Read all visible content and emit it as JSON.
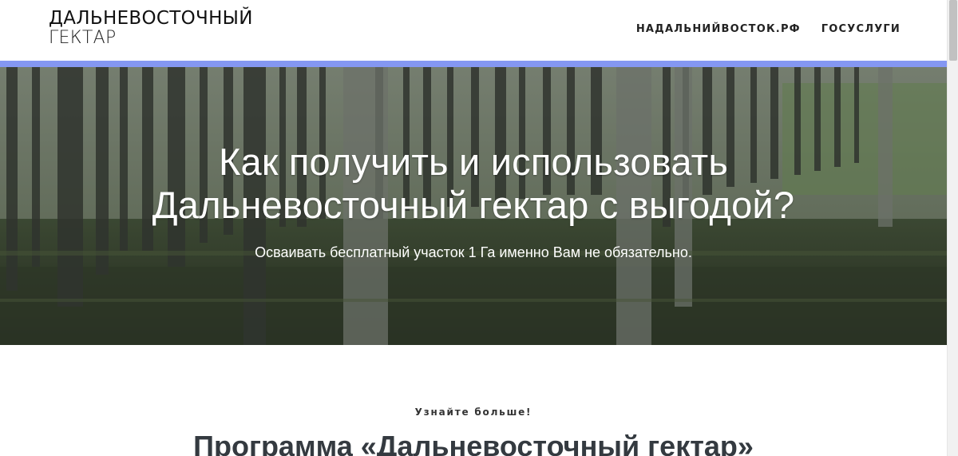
{
  "header": {
    "logo_line1": "ДАЛЬНЕВОСТОЧНЫЙ",
    "logo_line2": "ГЕКТАР",
    "nav": [
      {
        "label": "НАДАЛЬНИЙВОСТОК.РФ"
      },
      {
        "label": "ГОСУСЛУГИ"
      }
    ]
  },
  "colors": {
    "accent_bar": "#8497f2",
    "hero_text": "#ffffff",
    "section_title": "#343a40"
  },
  "hero": {
    "title_line1": "Как получить и использовать",
    "title_line2": "Дальневосточный гектар с выгодой?",
    "subtitle": "Осваивать бесплатный участок 1 Га именно Вам не обязательно."
  },
  "section": {
    "eyebrow": "Узнайте больше!",
    "title": "Программа «Дальневосточный гектар»"
  }
}
